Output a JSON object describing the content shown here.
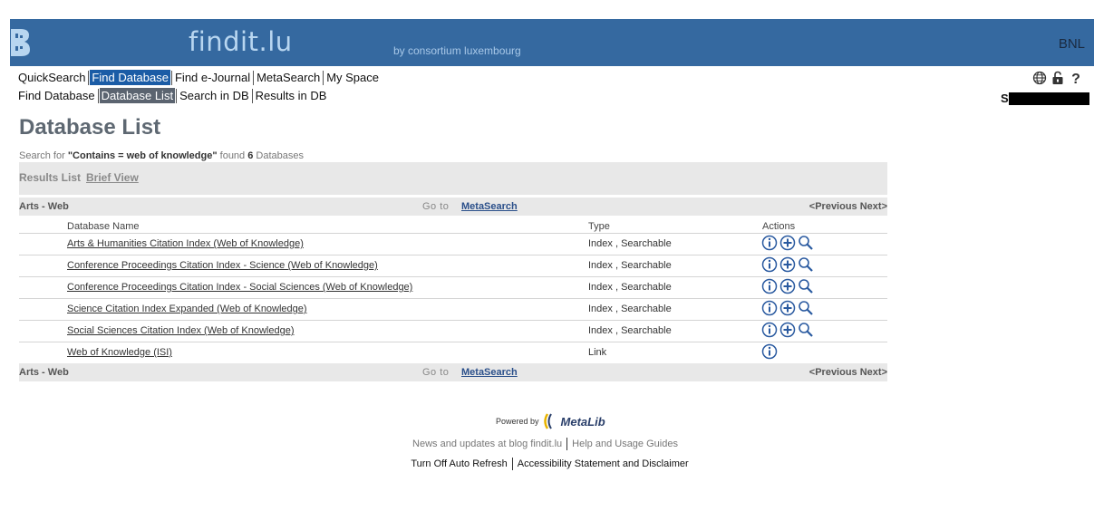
{
  "header": {
    "brand": "findit.lu",
    "byline": "by consortium luxembourg",
    "institution": "BNL",
    "bg_color": "#3569a0"
  },
  "nav_primary": [
    "QuickSearch",
    "Find Database",
    "Find e-Journal",
    "MetaSearch",
    "My Space"
  ],
  "nav_primary_active": "Find Database",
  "nav_secondary": [
    "Find Database",
    "Database List",
    "Search in DB",
    "Results in DB"
  ],
  "nav_secondary_active": "Database List",
  "tools": [
    "globe-icon",
    "lock-icon",
    "help-icon"
  ],
  "user": {
    "initial": "S"
  },
  "page": {
    "title": "Database List"
  },
  "search": {
    "prefix": "Search for",
    "query": "\"Contains = web of knowledge\"",
    "found_label": "found",
    "count": "6",
    "suffix": "Databases"
  },
  "view": {
    "label": "Results List",
    "brief": "Brief View"
  },
  "category": {
    "name": "Arts - Web",
    "goto": "Go to",
    "metasearch": "MetaSearch",
    "prev_next": "<Previous Next>"
  },
  "table": {
    "headers": {
      "name": "Database Name",
      "type": "Type",
      "actions": "Actions"
    },
    "rows": [
      {
        "name": "Arts & Humanities Citation Index (Web of Knowledge)",
        "type": "Index , Searchable",
        "actions": [
          "info",
          "add",
          "search"
        ]
      },
      {
        "name": "Conference Proceedings Citation Index - Science (Web of Knowledge)",
        "type": "Index , Searchable",
        "actions": [
          "info",
          "add",
          "search"
        ]
      },
      {
        "name": "Conference Proceedings Citation Index - Social Sciences (Web of Knowledge)",
        "type": "Index , Searchable",
        "actions": [
          "info",
          "add",
          "search"
        ]
      },
      {
        "name": "Science Citation Index Expanded (Web of Knowledge)",
        "type": "Index , Searchable",
        "actions": [
          "info",
          "add",
          "search"
        ]
      },
      {
        "name": "Social Sciences Citation Index (Web of Knowledge)",
        "type": "Index , Searchable",
        "actions": [
          "info",
          "add",
          "search"
        ]
      },
      {
        "name": "Web of Knowledge (ISI)",
        "type": "Link",
        "actions": [
          "info"
        ]
      }
    ]
  },
  "footer": {
    "powered_by": "Powered by",
    "product": "MetaLib",
    "link_news": "News and updates at blog findit.lu",
    "link_help": "Help and Usage Guides",
    "link_refresh": "Turn Off Auto Refresh",
    "link_accessibility": "Accessibility Statement and Disclaimer"
  }
}
